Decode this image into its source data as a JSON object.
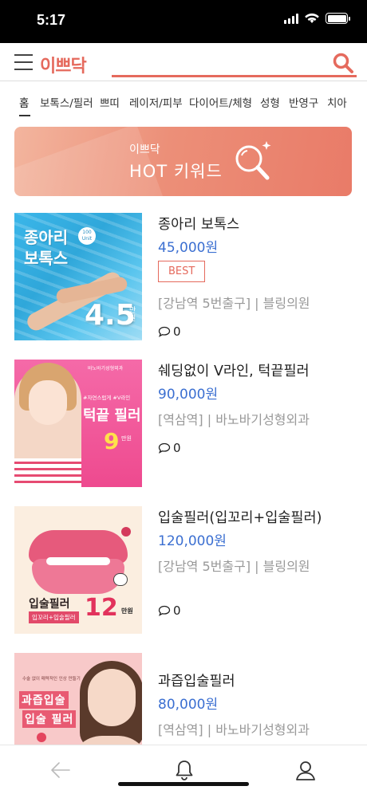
{
  "status_bar": {
    "time": "5:17"
  },
  "header": {
    "logo": "이쁘닥"
  },
  "categories": [
    {
      "label": "홈",
      "active": true
    },
    {
      "label": "보톡스/필러"
    },
    {
      "label": "쁘띠"
    },
    {
      "label": "레이저/피부"
    },
    {
      "label": "다이어트/체형"
    },
    {
      "label": "성형"
    },
    {
      "label": "반영구"
    },
    {
      "label": "치아"
    }
  ],
  "banner": {
    "subtitle": "이쁘닥",
    "title": "HOT 키워드",
    "icon": "magnifier-icon"
  },
  "items": [
    {
      "title": "종아리 보톡스",
      "price": "45,000원",
      "badge": "BEST",
      "location": "[강남역 5번출구] | 블링의원",
      "comments": "0",
      "thumb": {
        "text": "종아리\n보톡스",
        "unit": "100 Unit",
        "num": "4.5",
        "man": "만원"
      }
    },
    {
      "title": "쉐딩없이 V라인, 턱끝필러",
      "price": "90,000원",
      "location": "[역삼역]  | 바노바기성형외과",
      "comments": "0",
      "thumb": {
        "header": "바노바기성형외과",
        "tag": "#자연스럽게 #V라인",
        "headline": "턱끝 필러",
        "num": "9",
        "man": "만원"
      }
    },
    {
      "title": "입술필러(입꼬리+입술필러)",
      "price": "120,000원",
      "location": "[강남역 5번출구] | 블링의원",
      "comments": "0",
      "thumb": {
        "headline": "입술필러",
        "sub": "입꼬리+입술필러",
        "num": "12",
        "man": "만원"
      }
    },
    {
      "title": "과즙입술필러",
      "price": "80,000원",
      "location": "[역삼역]  | 바노바기성형외과",
      "thumb": {
        "small": "수술 없이 매력적인 인상 만들기",
        "h1": "과즙입술",
        "h2": "입술 필러"
      }
    }
  ],
  "colors": {
    "accent": "#e56a5d",
    "price": "#3b6fd1"
  }
}
